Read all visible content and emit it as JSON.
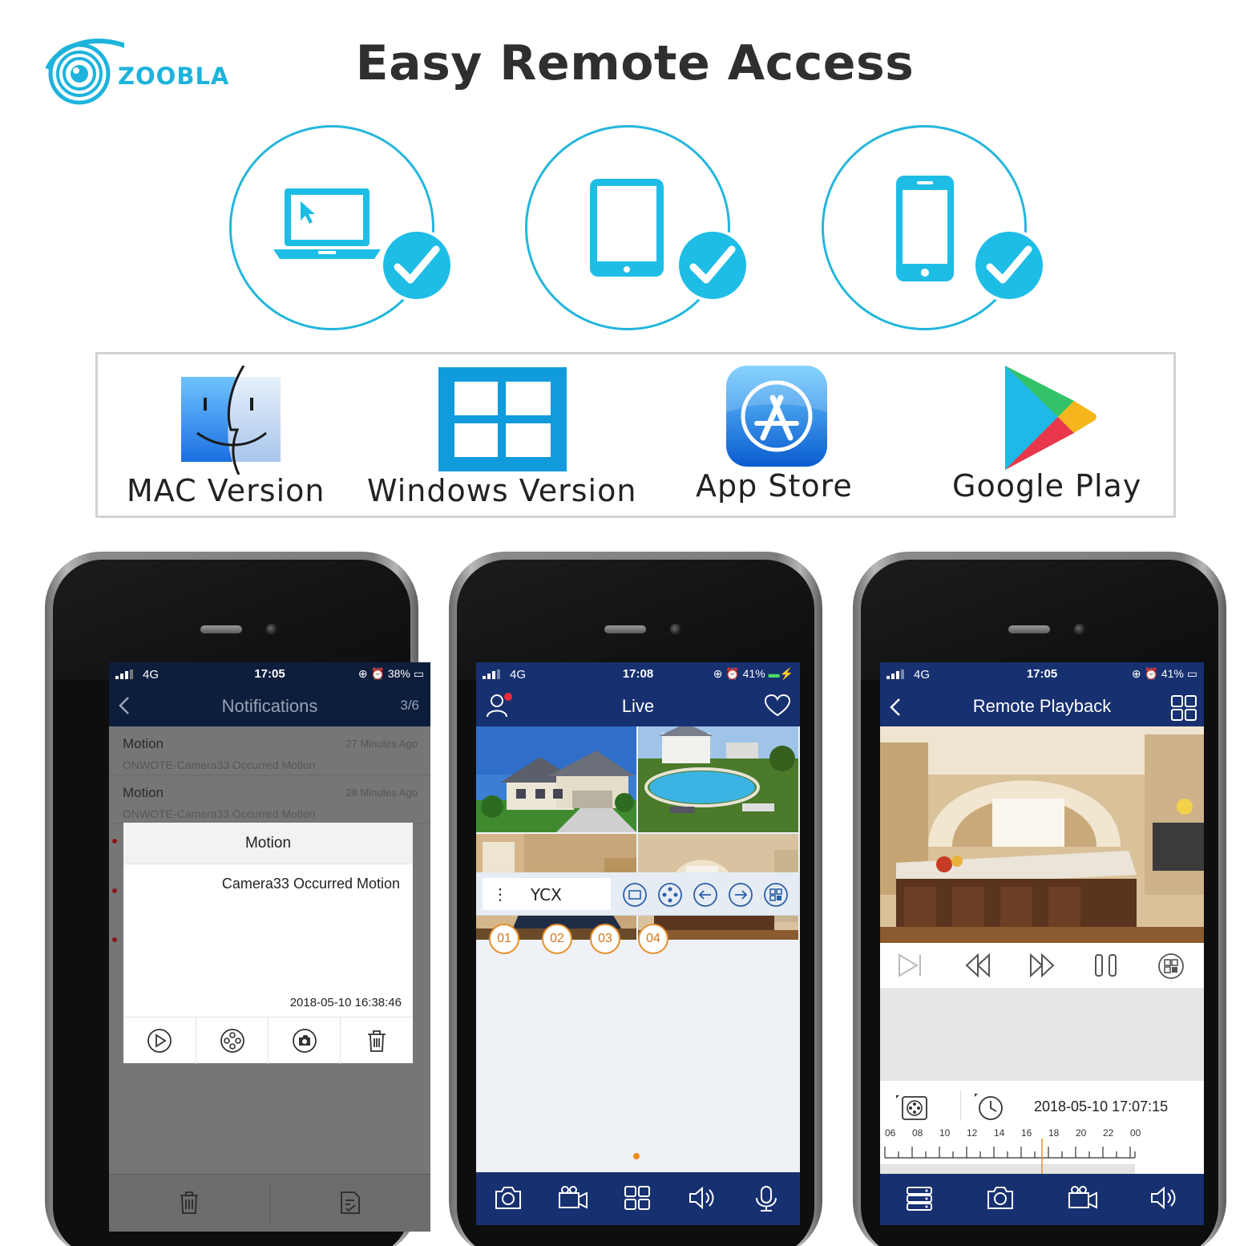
{
  "brand": {
    "name": "ZOOBLA"
  },
  "headline": "Easy Remote Access",
  "devices": [
    {
      "name": "laptop-icon"
    },
    {
      "name": "tablet-icon"
    },
    {
      "name": "smartphone-icon"
    }
  ],
  "platforms": [
    {
      "label": "MAC Version",
      "icon": "mac-finder-icon"
    },
    {
      "label": "Windows Version",
      "icon": "windows-logo-icon"
    },
    {
      "label": "App Store",
      "icon": "app-store-icon"
    },
    {
      "label": "Google Play",
      "icon": "google-play-icon"
    }
  ],
  "colors": {
    "accent": "#1ebde6",
    "navy": "#173070",
    "orange": "#e58f2c"
  },
  "phone_notifications": {
    "status": {
      "network": "4G",
      "time": "17:05",
      "battery": "38%"
    },
    "title": "Notifications",
    "count": "3/6",
    "items": [
      {
        "type": "Motion",
        "ago": "27 Minutes Ago",
        "desc": "ONWOTE-Camera33 Occurred Motion"
      },
      {
        "type": "Motion",
        "ago": "28 Minutes Ago",
        "desc": "ONWOTE-Camera33 Occurred Motion"
      }
    ],
    "dialog": {
      "title": "Motion",
      "message": "Camera33 Occurred Motion",
      "datetime": "2018-05-10 16:38:46"
    }
  },
  "phone_live": {
    "status": {
      "network": "4G",
      "time": "17:08",
      "battery": "41%"
    },
    "title": "Live",
    "device_name": "YCX",
    "channels": [
      "01",
      "02",
      "03",
      "04"
    ]
  },
  "phone_playback": {
    "status": {
      "network": "4G",
      "time": "17:05",
      "battery": "41%"
    },
    "title": "Remote Playback",
    "datetime": "2018-05-10 17:07:15",
    "timeline_hours": [
      "06",
      "08",
      "10",
      "12",
      "14",
      "16",
      "18",
      "20",
      "22",
      "00"
    ]
  }
}
